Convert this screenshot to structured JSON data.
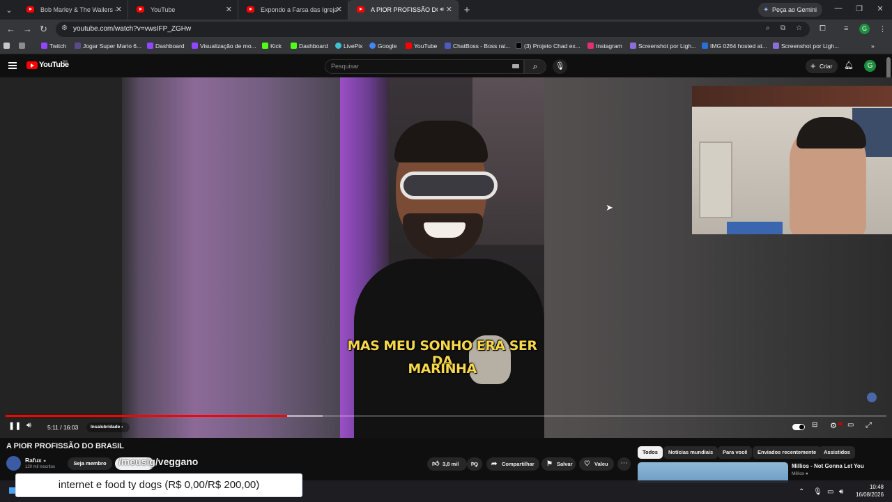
{
  "browser": {
    "tabs": [
      {
        "title": "Bob Marley & The Wailers - Exo",
        "active": false
      },
      {
        "title": "YouTube",
        "active": false
      },
      {
        "title": "Expondo a Farsa das Igrejas Eva",
        "active": false
      },
      {
        "title": "A PIOR PROFISSÃO DO BRA",
        "active": true
      }
    ],
    "gemini_label": "Peça ao Gemini",
    "url": "youtube.com/watch?v=vwsIFP_ZGHw",
    "profile_initial": "G",
    "bookmarks": [
      {
        "label": "Twitch",
        "color": "#9146ff"
      },
      {
        "label": "Jogar Super Mario 6...",
        "color": "#5a4a8a"
      },
      {
        "label": "Dashboard",
        "color": "#9146ff"
      },
      {
        "label": "Visualização de mo...",
        "color": "#9146ff"
      },
      {
        "label": "Kick",
        "color": "#53fc18"
      },
      {
        "label": "Dashboard",
        "color": "#53fc18"
      },
      {
        "label": "LivePix",
        "color": "#3ec1d3"
      },
      {
        "label": "Google",
        "color": "#4285f4"
      },
      {
        "label": "YouTube",
        "color": "#ff0000"
      },
      {
        "label": "ChatBoss - Boss rai...",
        "color": "#4a5cc2"
      },
      {
        "label": "(3) Projeto Chad ex...",
        "color": "#000000"
      },
      {
        "label": "Instagram",
        "color": "#e1306c"
      },
      {
        "label": "Screenshot por Ligh...",
        "color": "#8a6fd6"
      },
      {
        "label": "IMG 0264 hosted at...",
        "color": "#2a6fd6"
      },
      {
        "label": "Screenshot por Ligh...",
        "color": "#8a6fd6"
      }
    ]
  },
  "youtube": {
    "logo_text": "YouTube",
    "logo_region": "BR",
    "search_placeholder": "Pesquisar",
    "create_label": "Criar",
    "avatar_initial": "G"
  },
  "video": {
    "caption_line1": "MAS MEU SONHO ERA SER DA",
    "caption_line2": "MARINHA",
    "current_time": "5:11",
    "duration": "16:03",
    "time_display": "5:11 / 16:03",
    "chapter": "Insalubridade",
    "progress_played": 0.32,
    "progress_buffered": 0.36
  },
  "details": {
    "title": "A PIOR PROFISSÃO DO BRASIL",
    "channel_name": "Rafux",
    "subscribers": "120 mil inscritos",
    "member_label": "Seja membro",
    "overlay_text": "/meusig/veggano",
    "likes": "3,8 mil",
    "share_label": "Compartilhar",
    "save_label": "Salvar",
    "thanks_label": "Valeu"
  },
  "chips": [
    {
      "label": "Todos",
      "selected": true
    },
    {
      "label": "Notícias mundiais",
      "selected": false
    },
    {
      "label": "Para você",
      "selected": false
    },
    {
      "label": "Enviados recentemente",
      "selected": false
    },
    {
      "label": "Assistidos",
      "selected": false
    }
  ],
  "recommendation": {
    "title": "Millios - Not Gonna Let You",
    "channel": "Millios"
  },
  "donation_bar": "internet e food ty dogs (R$ 0,00/R$ 200,00)",
  "taskbar": {
    "time": "10:48",
    "date": "16/08/2026"
  }
}
